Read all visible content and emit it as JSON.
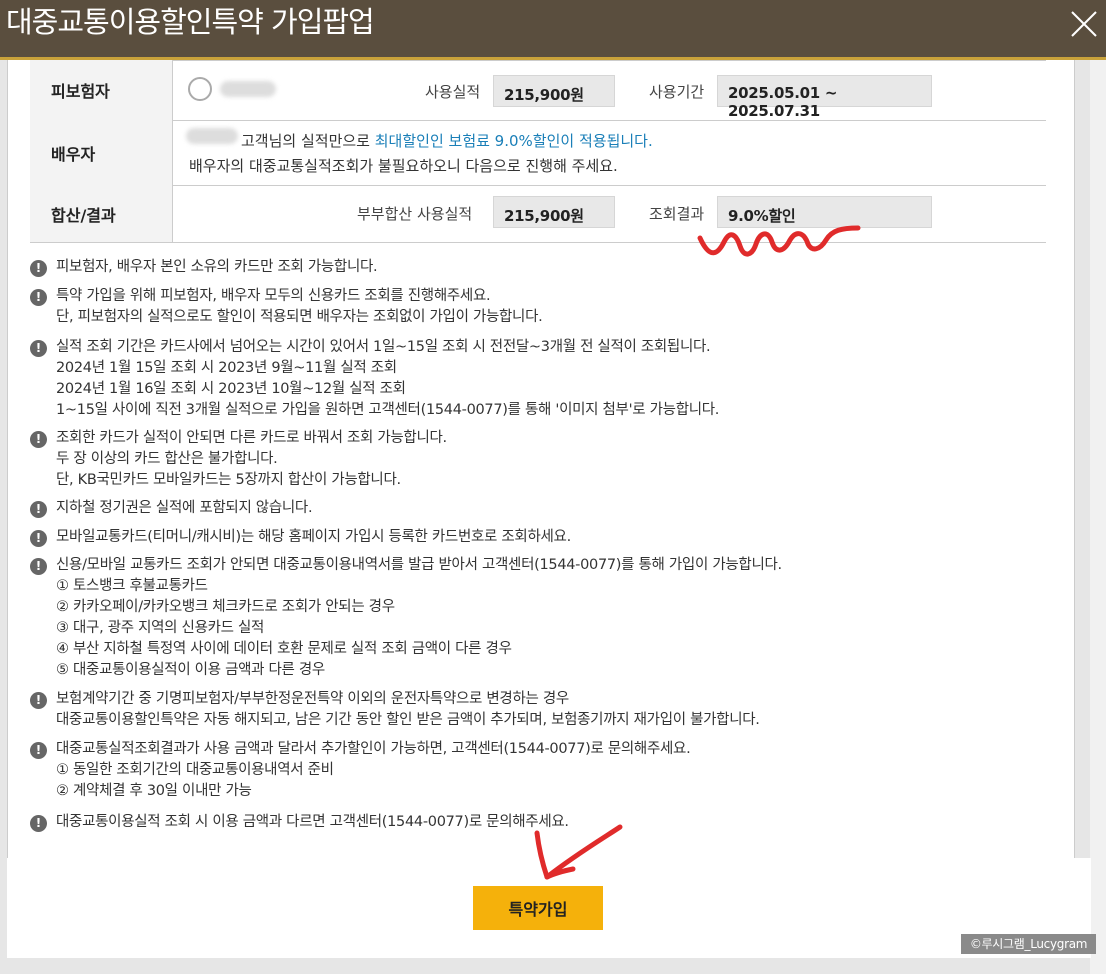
{
  "title": "대중교통이용할인특약 가입팝업",
  "rows": {
    "insured": {
      "header": "피보험자",
      "usage_label": "사용실적",
      "usage_value": "215,900원",
      "period_label": "사용기간",
      "period_value": "2025.05.01 ~ 2025.07.31"
    },
    "spouse": {
      "header": "배우자",
      "line1_pre": "고객님의 실적만으로 ",
      "line1_highlight": "최대할인인 보험료 9.0%할인이 적용됩니다.",
      "line2": "배우자의 대중교통실적조회가 불필요하오니 다음으로 진행해 주세요."
    },
    "result": {
      "header": "합산/결과",
      "combined_label": "부부합산 사용실적",
      "combined_value": "215,900원",
      "result_label": "조회결과",
      "result_value": "9.0%할인"
    }
  },
  "notes": [
    [
      "피보험자, 배우자 본인 소유의 카드만 조회 가능합니다."
    ],
    [
      "특약 가입을 위해 피보험자, 배우자 모두의 신용카드 조회를 진행해주세요.",
      "단, 피보험자의 실적으로도 할인이 적용되면 배우자는 조회없이 가입이 가능합니다."
    ],
    [
      "실적 조회 기간은 카드사에서 넘어오는 시간이 있어서 1일~15일 조회 시 전전달~3개월 전 실적이 조회됩니다.",
      "2024년 1월 15일 조회 시 2023년 9월~11월 실적 조회",
      "2024년 1월 16일 조회 시 2023년 10월~12월 실적 조회",
      "1~15일 사이에 직전 3개월 실적으로 가입을 원하면 고객센터(1544-0077)를 통해 '이미지 첨부'로 가능합니다."
    ],
    [
      "조회한 카드가 실적이 안되면 다른 카드로 바꿔서 조회 가능합니다.",
      "두 장 이상의 카드 합산은 불가합니다.",
      "단, KB국민카드 모바일카드는 5장까지 합산이 가능합니다."
    ],
    [
      "지하철 정기권은 실적에 포함되지 않습니다."
    ],
    [
      "모바일교통카드(티머니/캐시비)는 해당 홈페이지 가입시 등록한 카드번호로 조회하세요."
    ],
    [
      "신용/모바일 교통카드 조회가 안되면 대중교통이용내역서를 발급 받아서 고객센터(1544-0077)를 통해 가입이 가능합니다.",
      "① 토스뱅크 후불교통카드",
      "② 카카오페이/카카오뱅크 체크카드로 조회가 안되는 경우",
      "③ 대구, 광주 지역의 신용카드 실적",
      "④ 부산 지하철 특정역 사이에 데이터 호환 문제로 실적 조회 금액이 다른 경우",
      "⑤ 대중교통이용실적이 이용 금액과 다른 경우"
    ],
    [
      "보험계약기간 중 기명피보험자/부부한정운전특약 이외의 운전자특약으로 변경하는 경우",
      "대중교통이용할인특약은 자동 해지되고, 남은 기간 동안 할인 받은 금액이 추가되며, 보험종기까지 재가입이 불가합니다."
    ],
    [
      "대중교통실적조회결과가 사용 금액과 달라서 추가할인이 가능하면, 고객센터(1544-0077)로 문의해주세요.",
      "① 동일한 조회기간의 대중교통이용내역서 준비",
      "② 계약체결 후 30일 이내만 가능"
    ],
    [
      "대중교통이용실적 조회 시 이용 금액과 다르면 고객센터(1544-0077)로 문의해주세요."
    ]
  ],
  "note_icon": "exclamation-icon",
  "join_button": "특약가입",
  "watermark": "©루시그램_Lucygram",
  "colors": {
    "titlebar": "#5a4e3e",
    "accent_gold": "#f5b10b",
    "link_blue": "#1a7fb8",
    "annotation_red": "#e02b2b"
  }
}
